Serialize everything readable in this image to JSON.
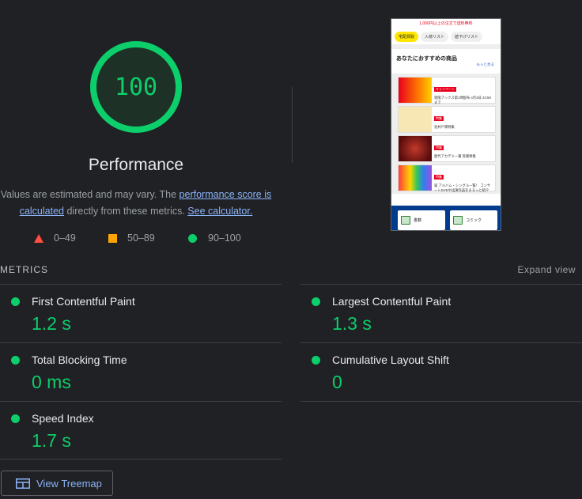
{
  "score": {
    "value": "100",
    "title": "Performance",
    "color": "#0cce6b"
  },
  "description": {
    "prefix": "Values are estimated and may vary. The ",
    "link_score": "performance score is calculated",
    "middle": " directly from these metrics. ",
    "link_calc": "See calculator."
  },
  "legend": {
    "fail": "0–49",
    "average": "50–89",
    "pass": "90–100"
  },
  "screenshot": {
    "banner": "1,000円以上の注文で送料無料",
    "tabs": [
      "宅配買取",
      "入荷リスト",
      "値下げリスト"
    ],
    "section_title": "あなたにおすすめの商品",
    "more": "もっと見る",
    "items": [
      {
        "badge": "キャンペーン",
        "desc": "冒険ブックス第1弾配布 4月3日 23:59まで"
      },
      {
        "badge": "特集",
        "desc": "池井戸潤特集"
      },
      {
        "badge": "特集",
        "desc": "歴代アカデミー賞 受賞特集"
      },
      {
        "badge": "特集",
        "desc": "嵐 アルバム・シングル一覧！ コンサートDVDや出演作品をまるっと紹介"
      }
    ],
    "nav": [
      "書籍",
      "コミック"
    ]
  },
  "metrics": {
    "section_label": "METRICS",
    "expand": "Expand view",
    "items": [
      {
        "name": "First Contentful Paint",
        "value": "1.2 s"
      },
      {
        "name": "Largest Contentful Paint",
        "value": "1.3 s"
      },
      {
        "name": "Total Blocking Time",
        "value": "0 ms"
      },
      {
        "name": "Cumulative Layout Shift",
        "value": "0"
      },
      {
        "name": "Speed Index",
        "value": "1.7 s"
      }
    ]
  },
  "treemap_button": "View Treemap"
}
